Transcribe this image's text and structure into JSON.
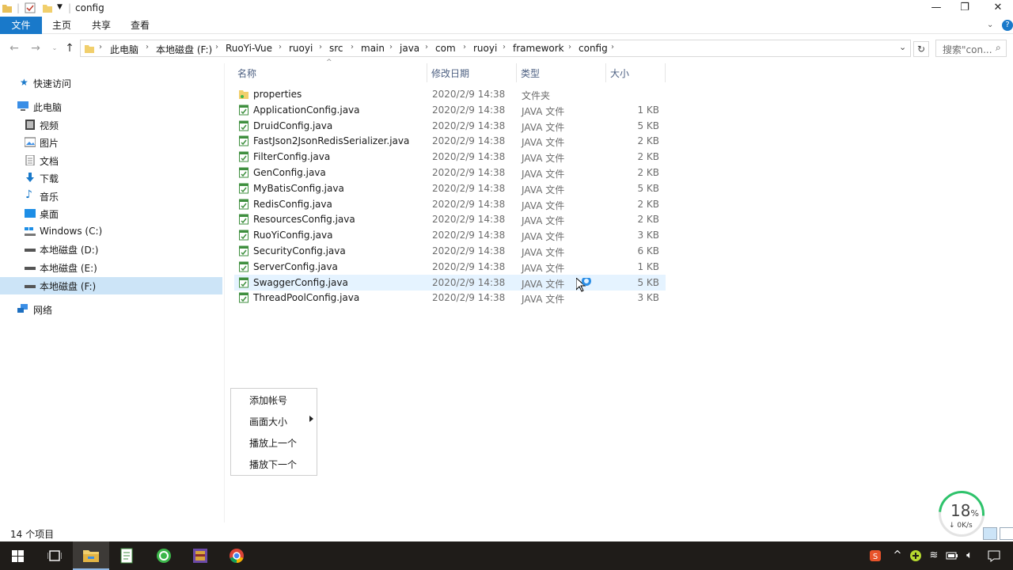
{
  "window": {
    "title": "config",
    "controls": {
      "minimize": "—",
      "restore": "❐",
      "close": "✕"
    }
  },
  "ribbon": {
    "tabs": [
      "文件",
      "主页",
      "共享",
      "查看"
    ],
    "active_tab": "文件",
    "help": "?"
  },
  "navigation": {
    "path": [
      "此电脑",
      "本地磁盘 (F:)",
      "RuoYi-Vue",
      "ruoyi",
      "src",
      "main",
      "java",
      "com",
      "ruoyi",
      "framework",
      "config"
    ],
    "search_placeholder": "搜索\"con..."
  },
  "sidebar": {
    "items": [
      {
        "label": "快速访问",
        "icon": "star-icon"
      },
      {
        "label": "此电脑",
        "icon": "computer-icon"
      },
      {
        "label": "视频",
        "icon": "video-icon"
      },
      {
        "label": "图片",
        "icon": "pictures-icon"
      },
      {
        "label": "文档",
        "icon": "documents-icon"
      },
      {
        "label": "下载",
        "icon": "download-icon"
      },
      {
        "label": "音乐",
        "icon": "music-icon"
      },
      {
        "label": "桌面",
        "icon": "desktop-icon"
      },
      {
        "label": "Windows (C:)",
        "icon": "windows-drive-icon"
      },
      {
        "label": "本地磁盘 (D:)",
        "icon": "drive-icon"
      },
      {
        "label": "本地磁盘 (E:)",
        "icon": "drive-icon"
      },
      {
        "label": "本地磁盘 (F:)",
        "icon": "drive-icon"
      },
      {
        "label": "网络",
        "icon": "network-icon"
      }
    ],
    "selected": "本地磁盘 (F:)"
  },
  "columns": {
    "name": "名称",
    "modified": "修改日期",
    "type": "类型",
    "size": "大小"
  },
  "files": [
    {
      "name": "properties",
      "modified": "2020/2/9 14:38",
      "type": "文件夹",
      "size": "",
      "icon": "folder-icon"
    },
    {
      "name": "ApplicationConfig.java",
      "modified": "2020/2/9 14:38",
      "type": "JAVA 文件",
      "size": "1 KB",
      "icon": "java-file-icon"
    },
    {
      "name": "DruidConfig.java",
      "modified": "2020/2/9 14:38",
      "type": "JAVA 文件",
      "size": "5 KB",
      "icon": "java-file-icon"
    },
    {
      "name": "FastJson2JsonRedisSerializer.java",
      "modified": "2020/2/9 14:38",
      "type": "JAVA 文件",
      "size": "2 KB",
      "icon": "java-file-icon"
    },
    {
      "name": "FilterConfig.java",
      "modified": "2020/2/9 14:38",
      "type": "JAVA 文件",
      "size": "2 KB",
      "icon": "java-file-icon"
    },
    {
      "name": "GenConfig.java",
      "modified": "2020/2/9 14:38",
      "type": "JAVA 文件",
      "size": "2 KB",
      "icon": "java-file-icon"
    },
    {
      "name": "MyBatisConfig.java",
      "modified": "2020/2/9 14:38",
      "type": "JAVA 文件",
      "size": "5 KB",
      "icon": "java-file-icon"
    },
    {
      "name": "RedisConfig.java",
      "modified": "2020/2/9 14:38",
      "type": "JAVA 文件",
      "size": "2 KB",
      "icon": "java-file-icon"
    },
    {
      "name": "ResourcesConfig.java",
      "modified": "2020/2/9 14:38",
      "type": "JAVA 文件",
      "size": "2 KB",
      "icon": "java-file-icon"
    },
    {
      "name": "RuoYiConfig.java",
      "modified": "2020/2/9 14:38",
      "type": "JAVA 文件",
      "size": "3 KB",
      "icon": "java-file-icon"
    },
    {
      "name": "SecurityConfig.java",
      "modified": "2020/2/9 14:38",
      "type": "JAVA 文件",
      "size": "6 KB",
      "icon": "java-file-icon"
    },
    {
      "name": "ServerConfig.java",
      "modified": "2020/2/9 14:38",
      "type": "JAVA 文件",
      "size": "1 KB",
      "icon": "java-file-icon"
    },
    {
      "name": "SwaggerConfig.java",
      "modified": "2020/2/9 14:38",
      "type": "JAVA 文件",
      "size": "5 KB",
      "icon": "java-file-icon"
    },
    {
      "name": "ThreadPoolConfig.java",
      "modified": "2020/2/9 14:38",
      "type": "JAVA 文件",
      "size": "3 KB",
      "icon": "java-file-icon"
    }
  ],
  "hovered_file": "SwaggerConfig.java",
  "context_menu": {
    "items": [
      "添加帐号",
      "画面大小",
      "播放上一个",
      "播放下一个"
    ],
    "submenu_item": "画面大小"
  },
  "status_bar": {
    "item_count": "14 个项目"
  },
  "net_meter": {
    "percent": "18",
    "percent_unit": "%",
    "speed": "↓ 0K/s"
  },
  "taskbar": {
    "apps": [
      {
        "name": "start-icon"
      },
      {
        "name": "task-view-icon"
      },
      {
        "name": "file-explorer-icon",
        "active": true
      },
      {
        "name": "notepad-icon"
      },
      {
        "name": "360-browser-icon"
      },
      {
        "name": "winrar-icon"
      },
      {
        "name": "chrome-icon"
      }
    ],
    "tray": [
      "ime-sogou-icon",
      "chevron-up-icon",
      "plus-icon",
      "wifi-icon",
      "battery-icon",
      "volume-icon",
      "notification-icon"
    ]
  },
  "colors": {
    "accent": "#1979ca",
    "selection": "#cce4f7",
    "hover": "#e5f3ff",
    "header_text": "#4d6082"
  }
}
